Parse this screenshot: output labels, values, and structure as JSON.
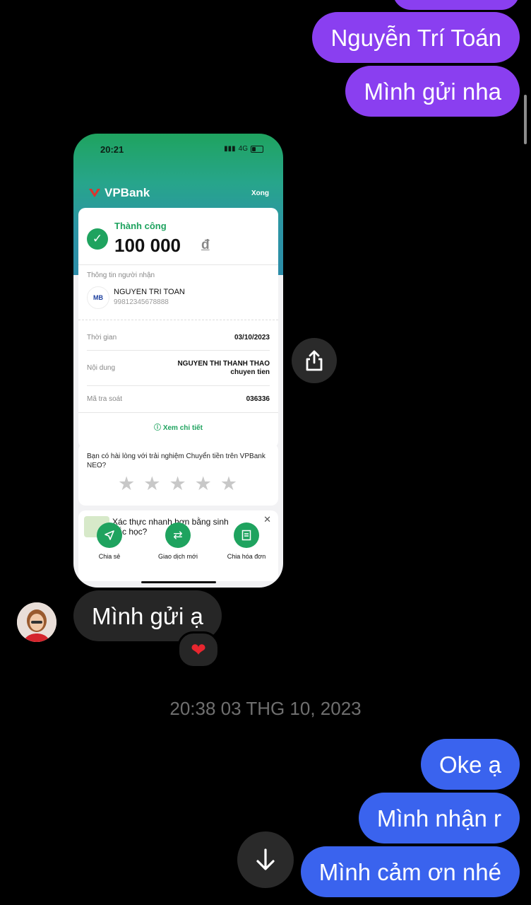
{
  "messages_top": [
    {
      "text": "Nguyễn Trí Toán"
    },
    {
      "text": "Mình gửi nha"
    }
  ],
  "shared_screenshot": {
    "status_time": "20:21",
    "network": "4G",
    "bank_logo": "VPBank",
    "done_label": "Xong",
    "success_label": "Thành công",
    "amount": "100 000",
    "currency": "đ",
    "recipient_section_label": "Thông tin người nhận",
    "recipient_bank_logo": "MB",
    "recipient_name": "NGUYEN TRI TOAN",
    "recipient_account": "99812345678888",
    "time_label": "Thời gian",
    "time_value": "03/10/2023",
    "content_label": "Nội dung",
    "content_line1": "NGUYEN THI THANH THAO",
    "content_line2": "chuyen tien",
    "trace_label": "Mã tra soát",
    "trace_value": "036336",
    "detail_link": "Xem chi tiết",
    "rating_question": "Bạn có hài lòng với trải nghiệm Chuyển tiền trên VPBank NEO?",
    "promo_text": "Xác thực nhanh hơn bằng sinh trắc học?",
    "actions": [
      {
        "label": "Chia sẻ",
        "icon": "send-icon"
      },
      {
        "label": "Giao dịch mới",
        "icon": "swap-icon"
      },
      {
        "label": "Chia hóa đơn",
        "icon": "bill-icon"
      }
    ]
  },
  "received_message": {
    "text": "Mình gửi ạ",
    "reaction": "❤"
  },
  "timestamp": "20:38 03 THG 10, 2023",
  "messages_bottom": [
    {
      "text": "Oke ạ"
    },
    {
      "text": "Mình nhận r"
    },
    {
      "text": "Mình cảm ơn nhé"
    }
  ],
  "colors": {
    "sent_purple": "#8a3ff0",
    "sent_blue": "#3a63ee",
    "received_bubble": "#262626",
    "vpbank_green": "#1fa35f"
  }
}
